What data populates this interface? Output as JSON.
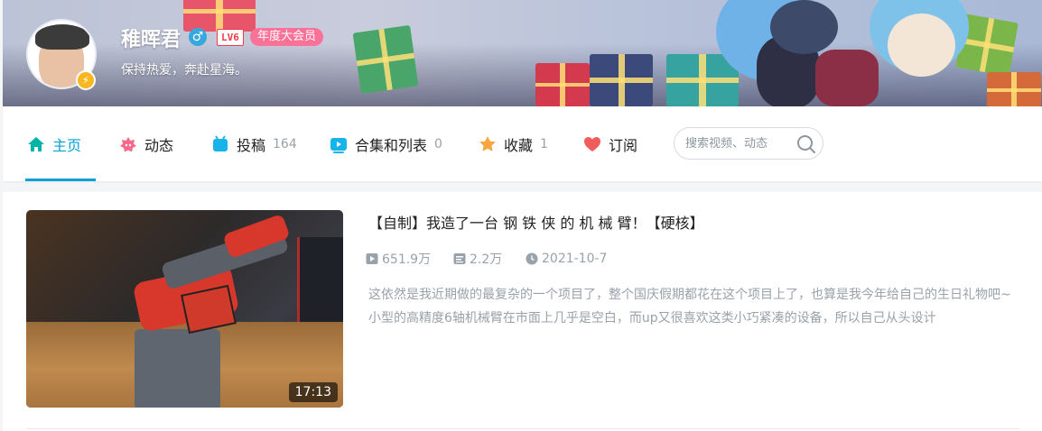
{
  "profile": {
    "name": "稚晖君",
    "gender": "♂",
    "level": "LV6",
    "vip_label": "年度大会员",
    "sign": "保持热爱，奔赴星海。",
    "badge_icon": "lightning-icon"
  },
  "nav": {
    "items": [
      {
        "label": "主页",
        "count": "",
        "icon": "home-icon",
        "color": "#00b5a5"
      },
      {
        "label": "动态",
        "count": "",
        "icon": "dynamic-icon",
        "color": "#f76a8a"
      },
      {
        "label": "投稿",
        "count": "164",
        "icon": "upload-icon",
        "color": "#17b4ea"
      },
      {
        "label": "合集和列表",
        "count": "0",
        "icon": "collection-icon",
        "color": "#17b4ea"
      },
      {
        "label": "收藏",
        "count": "1",
        "icon": "favorite-icon",
        "color": "#f7a540"
      },
      {
        "label": "订阅",
        "count": "",
        "icon": "subscribe-icon",
        "color": "#f25c5c"
      }
    ],
    "active_index": 0,
    "active_color": "#00a1d6",
    "search_placeholder": "搜索视频、动态"
  },
  "video": {
    "title": "【自制】我造了一台 钢 铁 侠 的 机 械 臂！【硬核】",
    "duration": "17:13",
    "plays": "651.9万",
    "danmaku": "2.2万",
    "date": "2021-10-7",
    "description": "这依然是我近期做的最复杂的一个项目了，整个国庆假期都花在这个项目上了，也算是我今年给自己的生日礼物吧~ 小型的高精度6轴机械臂在市面上几乎是空白，而up又很喜欢这类小巧紧凑的设备，所以自己从头设计"
  }
}
